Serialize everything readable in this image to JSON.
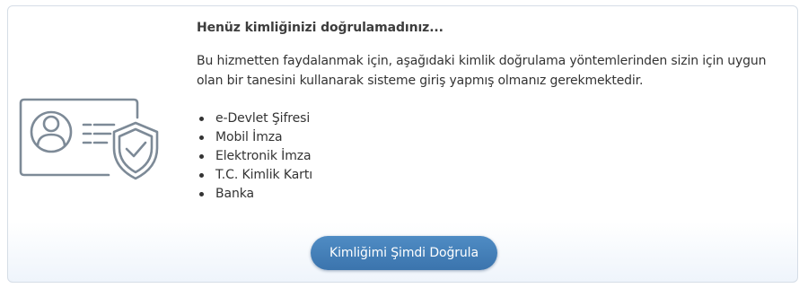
{
  "panel": {
    "title": "Henüz kimliğinizi doğrulamadınız...",
    "description": "Bu hizmetten faydalanmak için, aşağıdaki kimlik doğrulama yöntemlerinden sizin için uygun olan bir tanesini kullanarak sisteme giriş yapmış olmanız gerekmektedir.",
    "methods": [
      "e-Devlet Şifresi",
      "Mobil İmza",
      "Elektronik İmza",
      "T.C. Kimlik Kartı",
      "Banka"
    ],
    "verify_button_label": "Kimliğimi Şimdi Doğrula"
  },
  "icons": {
    "illustration": "identity-card-shield-icon"
  },
  "colors": {
    "button": "#4782ba",
    "icon_stroke": "#7d8a97",
    "text": "#333333"
  }
}
